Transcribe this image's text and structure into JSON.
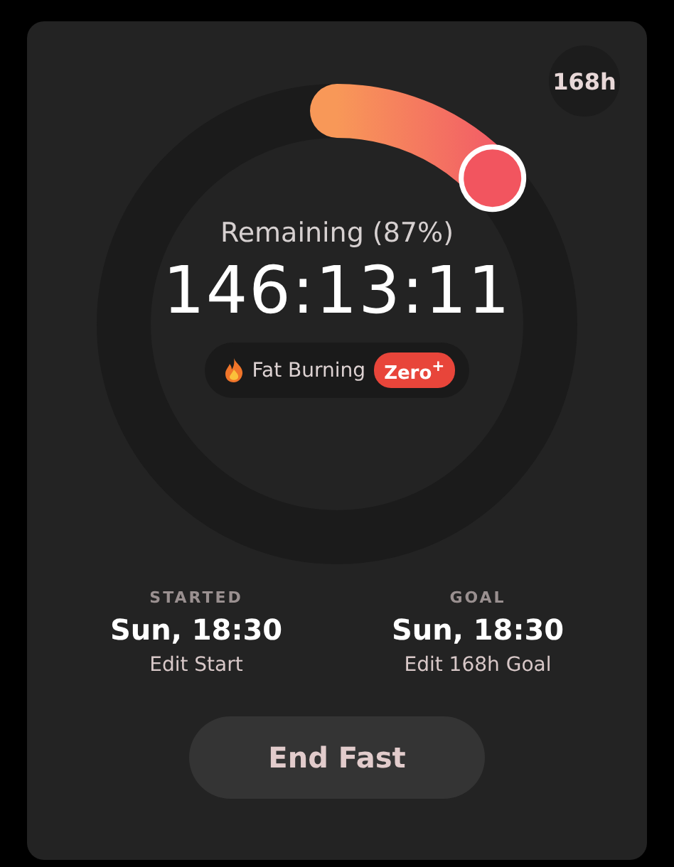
{
  "goal_badge": "168h",
  "remaining_label": "Remaining (87%)",
  "timer": "146:13:11",
  "stage": {
    "label": "Fat Burning",
    "tag": "Zero$^{+}$"
  },
  "stats": [
    {
      "label": "STARTED",
      "value": "Sun, 18:30",
      "action": "Edit Start"
    },
    {
      "label": "GOAL",
      "value": "Sun, 18:30",
      "action": "Edit 168h Goal"
    }
  ],
  "end_button": "End Fast"
}
